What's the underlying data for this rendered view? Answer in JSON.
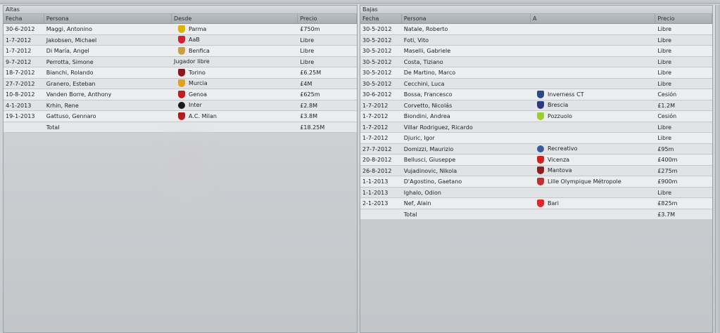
{
  "left_panel": {
    "title": "Altas",
    "columns": {
      "fecha": "Fecha",
      "persona": "Persona",
      "club": "Desde",
      "precio": "Precio"
    },
    "rows": [
      {
        "fecha": "30-6-2012",
        "persona": "Maggi, Antonino",
        "club": "Parma",
        "precio": "£750m",
        "crest": "#d9b400",
        "crest_icon": "parma-crest-icon"
      },
      {
        "fecha": "1-7-2012",
        "persona": "Jakobsen, Michael",
        "club": "AaB",
        "precio": "Libre",
        "crest": "#d42030",
        "crest_icon": "aab-crest-icon"
      },
      {
        "fecha": "1-7-2012",
        "persona": "Di María, Angel",
        "club": "Benfica",
        "precio": "Libre",
        "crest": "#c8a040",
        "crest_icon": "benfica-crest-icon"
      },
      {
        "fecha": "9-7-2012",
        "persona": "Perrotta, Simone",
        "club": "Jugador libre",
        "precio": "Libre",
        "crest": "",
        "crest_icon": ""
      },
      {
        "fecha": "18-7-2012",
        "persona": "Bianchi, Rolando",
        "club": "Torino",
        "precio": "£6.25M",
        "crest": "#8a1a1a",
        "crest_icon": "torino-crest-icon"
      },
      {
        "fecha": "27-7-2012",
        "persona": "Granero, Esteban",
        "club": "Murcia",
        "precio": "£4M",
        "crest": "#e0a020",
        "crest_icon": "murcia-crest-icon"
      },
      {
        "fecha": "10-8-2012",
        "persona": "Vanden Borre, Anthony",
        "club": "Genoa",
        "precio": "£625m",
        "crest": "#c02020",
        "crest_icon": "genoa-crest-icon"
      },
      {
        "fecha": "4-1-2013",
        "persona": "Krhin, Rene",
        "club": "Inter",
        "precio": "£2.8M",
        "crest": "#1a1a1a",
        "crest_icon": "inter-crest-icon"
      },
      {
        "fecha": "19-1-2013",
        "persona": "Gattuso, Gennaro",
        "club": "A.C. Milan",
        "precio": "£3.8M",
        "crest": "#b01818",
        "crest_icon": "milan-crest-icon"
      }
    ],
    "total_label": "Total",
    "total_value": "£18.25M"
  },
  "right_panel": {
    "title": "Bajas",
    "columns": {
      "fecha": "Fecha",
      "persona": "Persona",
      "club": "A",
      "precio": "Precio"
    },
    "rows": [
      {
        "fecha": "30-5-2012",
        "persona": "Natale, Roberto",
        "club": "",
        "precio": "Libre",
        "crest": "",
        "crest_icon": ""
      },
      {
        "fecha": "30-5-2012",
        "persona": "Foti, Vito",
        "club": "",
        "precio": "Libre",
        "crest": "",
        "crest_icon": ""
      },
      {
        "fecha": "30-5-2012",
        "persona": "Maselli, Gabriele",
        "club": "",
        "precio": "Libre",
        "crest": "",
        "crest_icon": ""
      },
      {
        "fecha": "30-5-2012",
        "persona": "Costa, Tiziano",
        "club": "",
        "precio": "Libre",
        "crest": "",
        "crest_icon": ""
      },
      {
        "fecha": "30-5-2012",
        "persona": "De Martino, Marco",
        "club": "",
        "precio": "Libre",
        "crest": "",
        "crest_icon": ""
      },
      {
        "fecha": "30-5-2012",
        "persona": "Cecchini, Luca",
        "club": "",
        "precio": "Libre",
        "crest": "",
        "crest_icon": ""
      },
      {
        "fecha": "30-6-2012",
        "persona": "Bossa, Francesco",
        "club": "Inverness CT",
        "precio": "Cesión",
        "crest": "#2a4a8a",
        "crest_icon": "inverness-crest-icon"
      },
      {
        "fecha": "1-7-2012",
        "persona": "Corvetto, Nicolás",
        "club": "Brescia",
        "precio": "£1.2M",
        "crest": "#2a3a7a",
        "crest_icon": "brescia-crest-icon"
      },
      {
        "fecha": "1-7-2012",
        "persona": "Biondini, Andrea",
        "club": "Pozzuolo",
        "precio": "Cesión",
        "crest": "#9acd32",
        "crest_icon": "pozzuolo-crest-icon"
      },
      {
        "fecha": "1-7-2012",
        "persona": "Villar Rodriguez, Ricardo",
        "club": "",
        "precio": "Libre",
        "crest": "",
        "crest_icon": ""
      },
      {
        "fecha": "1-7-2012",
        "persona": "Djuric, Igor",
        "club": "",
        "precio": "Libre",
        "crest": "",
        "crest_icon": ""
      },
      {
        "fecha": "27-7-2012",
        "persona": "Domizzi, Maurizio",
        "club": "Recreativo",
        "precio": "£95m",
        "crest": "#3a5a9a",
        "crest_icon": "recreativo-crest-icon"
      },
      {
        "fecha": "20-8-2012",
        "persona": "Bellusci, Giuseppe",
        "club": "Vicenza",
        "precio": "£400m",
        "crest": "#d02020",
        "crest_icon": "vicenza-crest-icon"
      },
      {
        "fecha": "26-8-2012",
        "persona": "Vujadinovic, Nikola",
        "club": "Mantova",
        "precio": "£275m",
        "crest": "#8a2020",
        "crest_icon": "mantova-crest-icon"
      },
      {
        "fecha": "1-1-2013",
        "persona": "D'Agostino, Gaetano",
        "club": "Lille Olympique Métropole",
        "precio": "£900m",
        "crest": "#c03030",
        "crest_icon": "lille-crest-icon"
      },
      {
        "fecha": "1-1-2013",
        "persona": "Ighalo, Odion",
        "club": "",
        "precio": "Libre",
        "crest": "",
        "crest_icon": ""
      },
      {
        "fecha": "2-1-2013",
        "persona": "Nef, Alain",
        "club": "Bari",
        "precio": "£825m",
        "crest": "#e02828",
        "crest_icon": "bari-crest-icon"
      }
    ],
    "total_label": "Total",
    "total_value": "£3.7M"
  }
}
